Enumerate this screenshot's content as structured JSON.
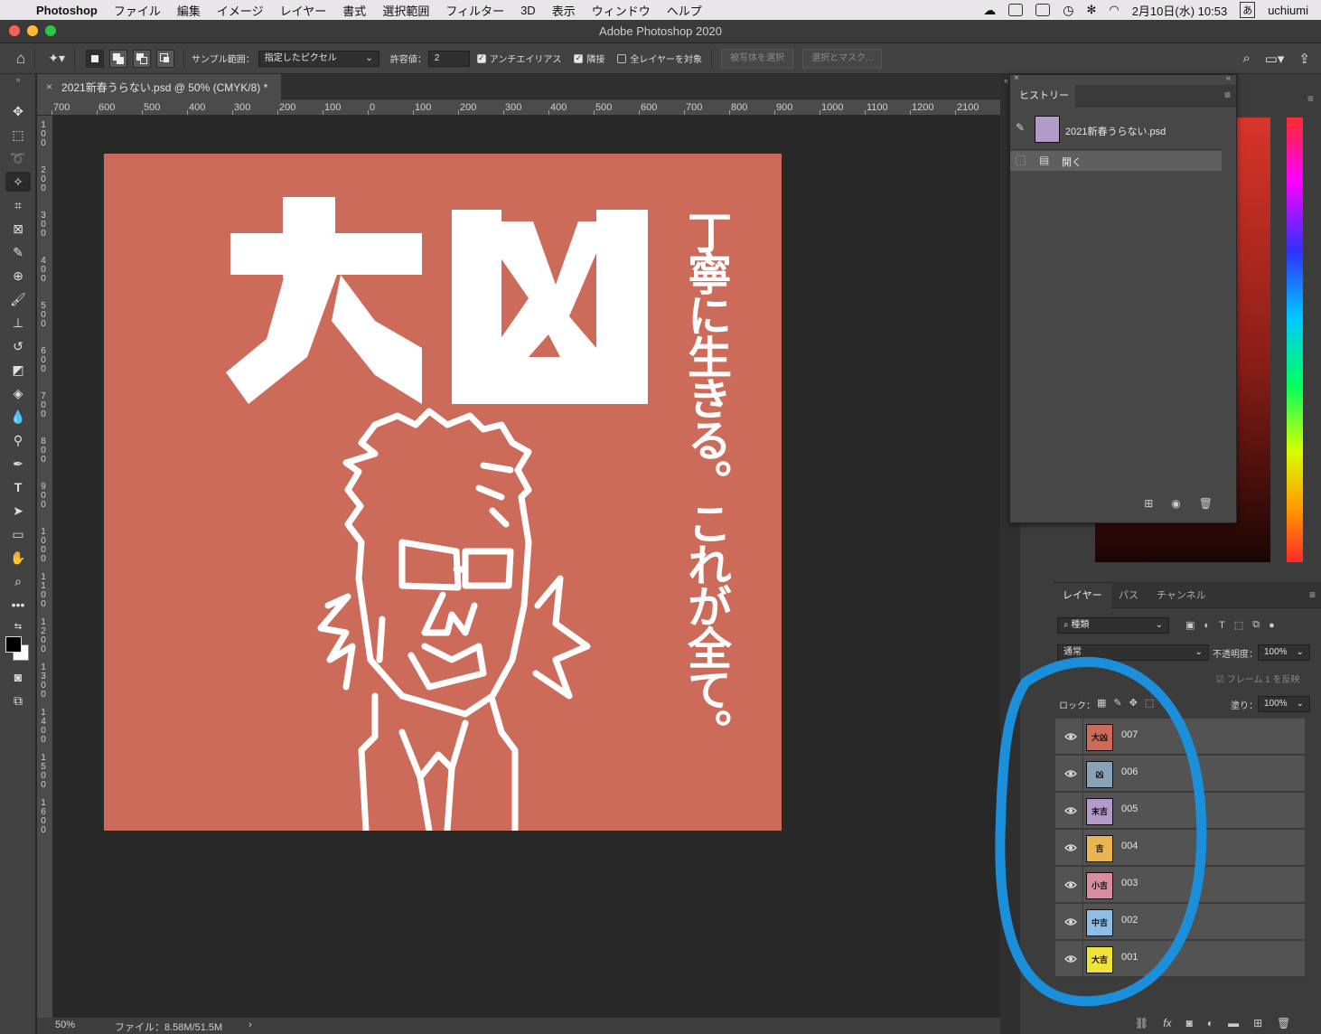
{
  "menubar": {
    "app_name": "Photoshop",
    "items": [
      "ファイル",
      "編集",
      "イメージ",
      "レイヤー",
      "書式",
      "選択範囲",
      "フィルター",
      "3D",
      "表示",
      "ウィンドウ",
      "ヘルプ"
    ],
    "datetime": "2月10日(水) 10:53",
    "ime": "あ",
    "user": "uchiumi"
  },
  "window": {
    "title": "Adobe Photoshop 2020"
  },
  "options": {
    "sample_label": "サンプル範囲：",
    "sample_value": "指定したピクセル",
    "tolerance_label": "許容値：",
    "tolerance_value": "2",
    "antialias_label": "アンチエイリアス",
    "contiguous_label": "隣接",
    "all_layers_label": "全レイヤーを対象",
    "select_subject": "被写体を選択",
    "select_mask": "選択とマスク..."
  },
  "document": {
    "tab_title": "2021新春うらない.psd @ 50% (CMYK/8) *",
    "zoom": "50%",
    "file_info": "ファイル：8.58M/51.5M"
  },
  "ruler_h": [
    "700",
    "600",
    "500",
    "400",
    "300",
    "200",
    "100",
    "0",
    "100",
    "200",
    "300",
    "400",
    "500",
    "600",
    "700",
    "800",
    "900",
    "1000",
    "1100",
    "1200",
    "2100"
  ],
  "ruler_v": [
    "100",
    "200",
    "300",
    "400",
    "500",
    "600",
    "700",
    "800",
    "900",
    "1000",
    "1100",
    "1200",
    "1300",
    "1400",
    "1500",
    "1600"
  ],
  "artwork": {
    "big_text": "大凶",
    "vertical_text": "丁寧に生きる。これが全て。",
    "bg_color": "#cd6b5b"
  },
  "history": {
    "tab": "ヒストリー",
    "snapshot": "2021新春うらない.psd",
    "states": [
      "開く"
    ]
  },
  "layers_panel": {
    "tabs": [
      "レイヤー",
      "パス",
      "チャンネル"
    ],
    "filter_kind": "種類",
    "blend_mode": "通常",
    "opacity_label": "不透明度：",
    "opacity_value": "100%",
    "frame_label": "フレーム 1 を反映",
    "lock_label": "ロック：",
    "fill_label": "塗り：",
    "fill_value": "100%",
    "layers": [
      {
        "name": "007",
        "thumb_text": "大凶",
        "color": "#cd6b5b"
      },
      {
        "name": "006",
        "thumb_text": "凶",
        "color": "#8aa2b8"
      },
      {
        "name": "005",
        "thumb_text": "末吉",
        "color": "#b39ac9"
      },
      {
        "name": "004",
        "thumb_text": "吉",
        "color": "#e8b552"
      },
      {
        "name": "003",
        "thumb_text": "小吉",
        "color": "#d88ea0"
      },
      {
        "name": "002",
        "thumb_text": "中吉",
        "color": "#8ebde8"
      },
      {
        "name": "001",
        "thumb_text": "大吉",
        "color": "#f0e33a"
      }
    ]
  },
  "colors": {
    "annotation_circle": "#1c8fdb"
  }
}
